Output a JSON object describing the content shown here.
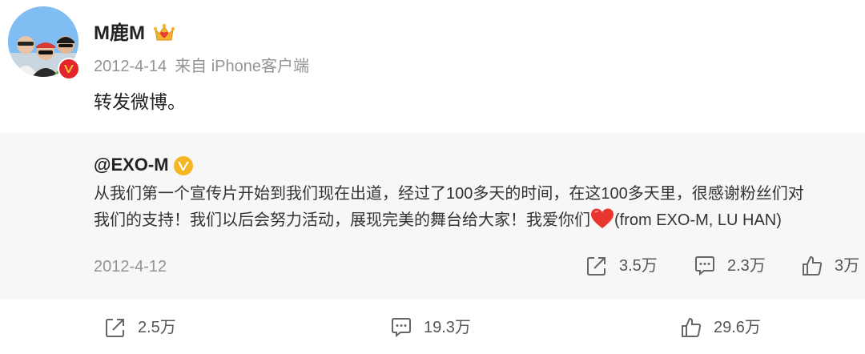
{
  "post": {
    "username": "M鹿M",
    "date": "2012-4-14",
    "source": "来自 iPhone客户端",
    "text": "转发微博。"
  },
  "repost": {
    "author": "@EXO-M",
    "lines": [
      "从我们第一个宣传片开始到我们现在出道，经过了100多天的时间，在这100多天里，很感谢粉丝们对",
      "我们的支持！我们以后会努力活动，展现完美的舞台给大家！我爱你们"
    ],
    "line2_suffix": "(from EXO-M, LU HAN)",
    "date": "2012-4-12",
    "actions": {
      "share_count": "3.5万",
      "comment_count": "2.3万",
      "like_count": "3万"
    }
  },
  "actions": {
    "share_count": "2.5万",
    "comment_count": "19.3万",
    "like_count": "29.6万"
  },
  "colors": {
    "verified_red": "#e4252c",
    "verified_gold": "#f5b623",
    "heart_red": "#e8352d",
    "meta_gray": "#939393",
    "repost_bg": "#f7f7f7"
  },
  "icons": [
    "crown-icon",
    "verified-badge-icon",
    "heart-icon",
    "share-icon",
    "comment-icon",
    "like-icon"
  ]
}
